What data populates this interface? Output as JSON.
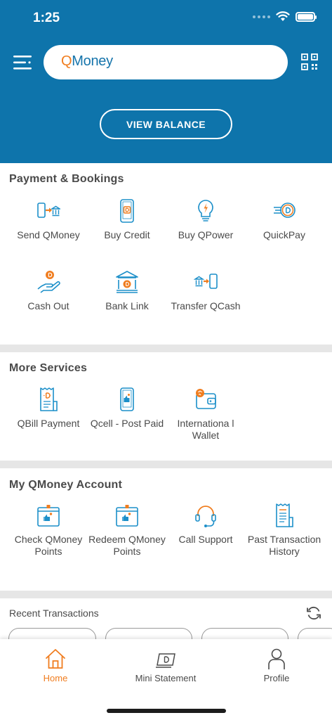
{
  "status_bar": {
    "time": "1:25"
  },
  "header": {
    "search_brand_q": "Q",
    "search_brand_rest": "Money",
    "view_balance_label": "VIEW BALANCE"
  },
  "colors": {
    "primary": "#0e74ab",
    "accent": "#f07d1f",
    "divider": "#e6e6e6"
  },
  "payment": {
    "title": "Payment & Bookings",
    "items": [
      {
        "label": "Send QMoney",
        "icon": "send-money-icon"
      },
      {
        "label": "Buy Credit",
        "icon": "buy-credit-icon"
      },
      {
        "label": "Buy QPower",
        "icon": "lightbulb-icon"
      },
      {
        "label": "QuickPay",
        "icon": "quickpay-icon"
      },
      {
        "label": "Cash Out",
        "icon": "cash-out-icon"
      },
      {
        "label": "Bank Link",
        "icon": "bank-icon"
      },
      {
        "label": "Transfer QCash",
        "icon": "transfer-icon"
      }
    ]
  },
  "more": {
    "title": "More Services",
    "items": [
      {
        "label": "QBill Payment",
        "icon": "bill-icon"
      },
      {
        "label": "Qcell - Post Paid",
        "icon": "phone-icon"
      },
      {
        "label": "Internationa l Wallet",
        "icon": "wallet-icon"
      }
    ]
  },
  "account": {
    "title": "My QMoney Account",
    "items": [
      {
        "label": "Check QMoney Points",
        "icon": "points-icon"
      },
      {
        "label": "Redeem QMoney Points",
        "icon": "redeem-icon"
      },
      {
        "label": "Call Support",
        "icon": "headset-icon"
      },
      {
        "label": "Past Transaction History",
        "icon": "receipt-icon"
      }
    ]
  },
  "recent": {
    "title": "Recent Transactions"
  },
  "nav": {
    "items": [
      {
        "label": "Home",
        "icon": "home-icon",
        "active": true
      },
      {
        "label": "Mini Statement",
        "icon": "mini-statement-icon",
        "active": false
      },
      {
        "label": "Profile",
        "icon": "profile-icon",
        "active": false
      }
    ]
  }
}
